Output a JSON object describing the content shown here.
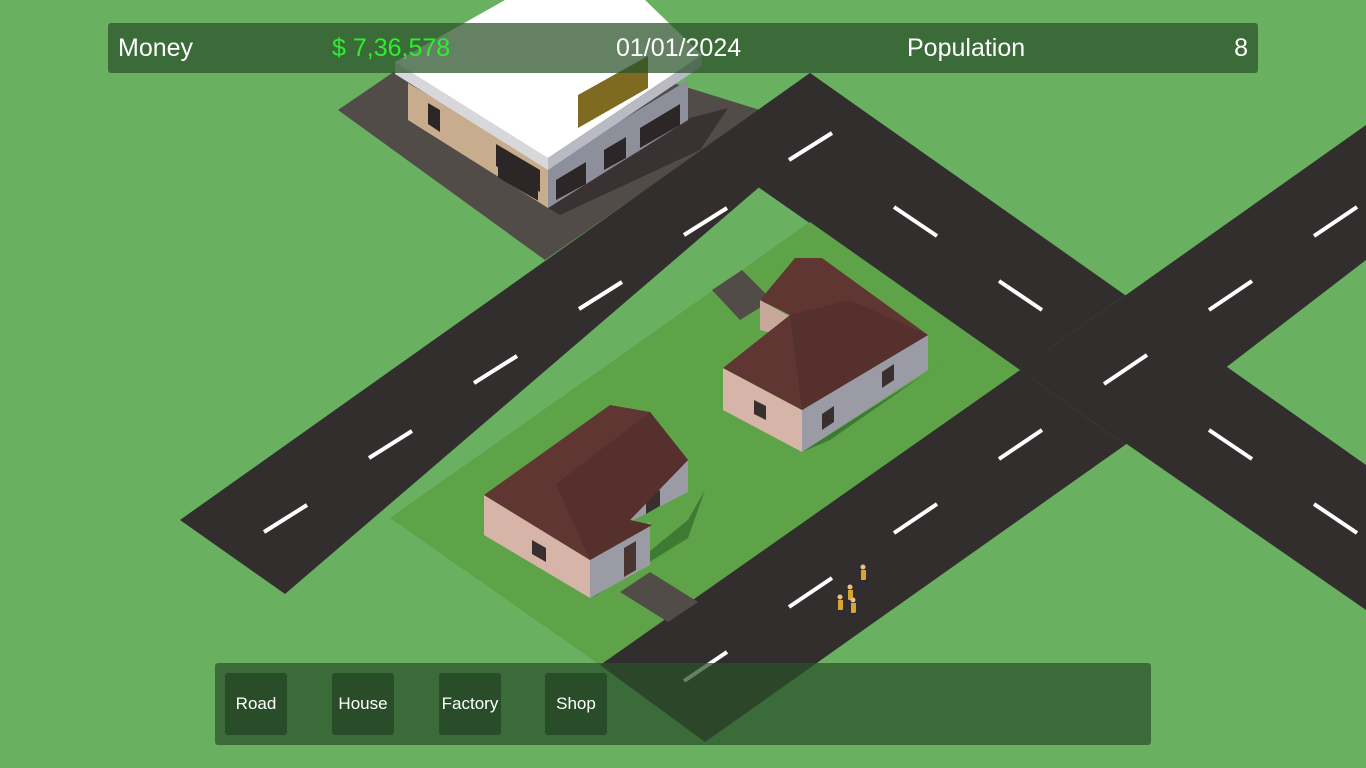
{
  "hud": {
    "money_label": "Money",
    "money_value": "$ 7,36,578",
    "date": "01/01/2024",
    "population_label": "Population",
    "population_value": "8"
  },
  "toolbar": {
    "road": "Road",
    "house": "House",
    "factory": "Factory",
    "shop": "Shop"
  },
  "colors": {
    "grass": "#69b061",
    "lot_grass": "#5ea347",
    "road": "#322e2e",
    "road_marking": "#ffffff",
    "roof": "#603632",
    "wall": "#d7b4a8",
    "hud_background": "#285028",
    "money_text": "#2eef2e",
    "button": "#2a4d29"
  }
}
